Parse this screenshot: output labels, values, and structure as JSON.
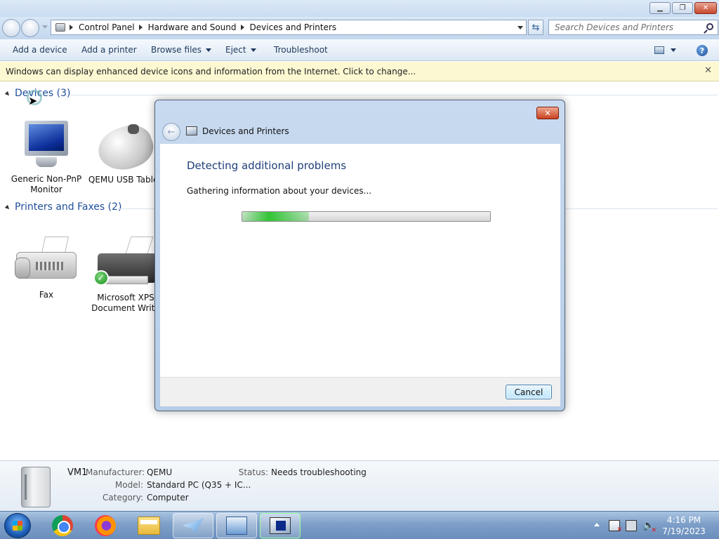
{
  "breadcrumbs": [
    "Control Panel",
    "Hardware and Sound",
    "Devices and Printers"
  ],
  "search": {
    "placeholder": "Search Devices and Printers"
  },
  "toolbar": {
    "add_device": "Add a device",
    "add_printer": "Add a printer",
    "browse_files": "Browse files",
    "eject": "Eject",
    "troubleshoot": "Troubleshoot"
  },
  "infobar": {
    "text": "Windows can display enhanced device icons and information from the Internet. Click to change..."
  },
  "groups": {
    "devices": {
      "title": "Devices (3)"
    },
    "printers": {
      "title": "Printers and Faxes (2)"
    }
  },
  "devices": [
    {
      "label": "Generic Non-PnP Monitor",
      "icon": "monitor-icon"
    },
    {
      "label": "QEMU USB Tablet",
      "icon": "mouse-icon"
    }
  ],
  "printers": [
    {
      "label": "Fax",
      "icon": "fax-icon"
    },
    {
      "label": "Microsoft XPS Document Write",
      "icon": "printer-icon",
      "default": true
    }
  ],
  "dialog": {
    "title": "Devices and Printers",
    "heading": "Detecting additional problems",
    "message": "Gathering information about your devices...",
    "progress": 0.27,
    "cancel": "Cancel"
  },
  "details": {
    "name": "VM1",
    "manufacturer_label": "Manufacturer:",
    "manufacturer": "QEMU",
    "model_label": "Model:",
    "model": "Standard PC (Q35 + IC...",
    "category_label": "Category:",
    "category": "Computer",
    "status_label": "Status:",
    "status": "Needs troubleshooting"
  },
  "taskbar": {
    "apps": [
      "chrome-icon",
      "firefox-icon",
      "explorer-icon",
      "mail-icon",
      "control-panel-icon",
      "devices-printers-icon"
    ],
    "time": "4:16 PM",
    "date": "7/19/2023"
  },
  "colors": {
    "link_blue": "#1e4e9a",
    "progress_green": "#31c335",
    "infobar_bg": "#fcf9d2"
  }
}
